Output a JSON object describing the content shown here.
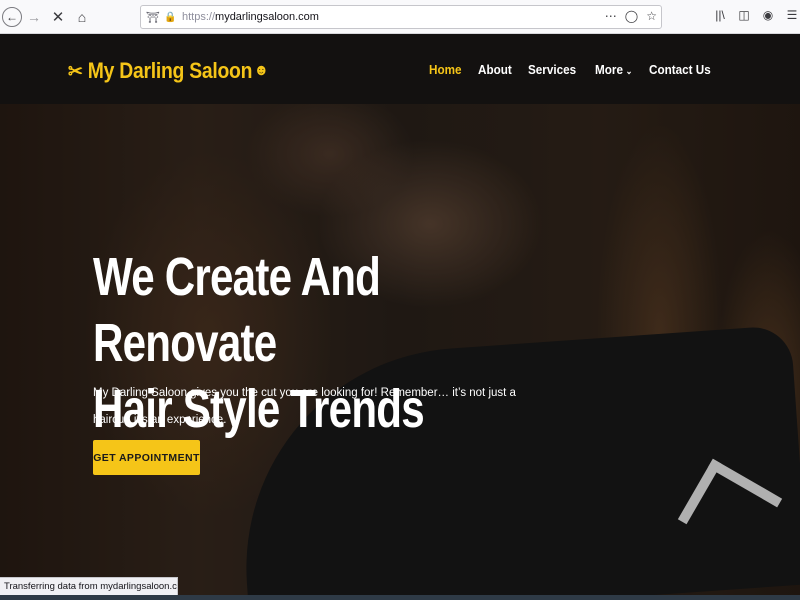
{
  "browser": {
    "back_icon": "arrow-left-icon",
    "forward_icon": "arrow-right-icon",
    "stop_icon": "close-icon",
    "home_icon": "home-icon",
    "url_scheme": "https://",
    "url_host": "mydarlingsaloon.com",
    "status_text": "Transferring data from mydarlingsaloon.com..."
  },
  "header": {
    "logo_text": "My Darling Saloon",
    "nav": [
      {
        "label": "Home",
        "active": true
      },
      {
        "label": "About",
        "active": false
      },
      {
        "label": "Services",
        "active": false
      },
      {
        "label": "More",
        "active": false
      },
      {
        "label": "Contact Us",
        "active": false
      }
    ]
  },
  "hero": {
    "title_line1": "We Create And Renovate",
    "title_line2": "Hair Style Trends",
    "subtitle": "My Darling Saloon gives you the cut you are looking for! Remember… it’s not just a haircut, it’s an experience.",
    "cta_label": "GET APPOINTMENT"
  },
  "colors": {
    "accent": "#f5c518",
    "header_bg": "#131110",
    "text": "#ffffff"
  }
}
